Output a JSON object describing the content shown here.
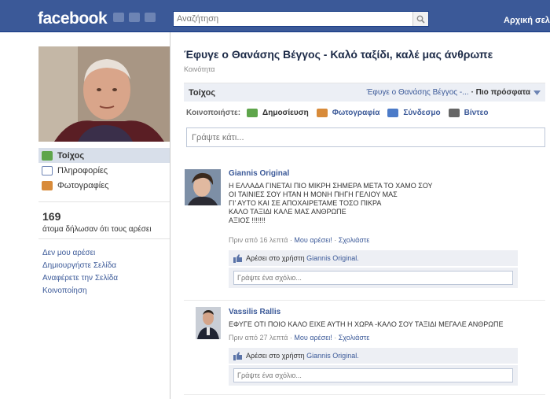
{
  "topbar": {
    "logo": "facebook",
    "search_placeholder": "Αναζήτηση",
    "home_link": "Αρχική σελί"
  },
  "sidebar": {
    "items": [
      {
        "label": "Τοίχος"
      },
      {
        "label": "Πληροφορίες"
      },
      {
        "label": "Φωτογραφίες"
      }
    ],
    "likes_count": "169",
    "likes_text": "άτομα δήλωσαν ότι τους αρέσει",
    "links": [
      {
        "label": "Δεν μου αρέσει"
      },
      {
        "label": "Δημιουργήστε Σελίδα"
      },
      {
        "label": "Αναφέρετε την Σελίδα"
      },
      {
        "label": "Κοινοποίηση"
      }
    ]
  },
  "page": {
    "title": "Έφυγε ο Θανάσης Βέγγος - Καλό ταξίδι, καλέ μας άνθρωπε",
    "category": "Κοινότητα"
  },
  "wall": {
    "tab": "Τοίχος",
    "filter": "Έφυγε ο Θανάσης Βέγγος -...",
    "sort": "· Πιο πρόσφατα"
  },
  "share": {
    "label": "Κοινοποιήστε:",
    "post": "Δημοσίευση",
    "photo": "Φωτογραφία",
    "link": "Σύνδεσμο",
    "video": "Βίντεο"
  },
  "composer": {
    "placeholder": "Γράψτε κάτι..."
  },
  "posts": [
    {
      "author": "Giannis Original",
      "lines": [
        "Η ΕΛΛΑΔΑ ΓΙΝΕΤΑΙ ΠΙΟ ΜΙΚΡΗ ΣΗΜΕΡΑ ΜΕΤΑ ΤΟ ΧΑΜΟ ΣΟΥ",
        "ΟΙ ΤΑΙΝΙΕΣ ΣΟΥ ΗΤΑΝ Η ΜΟΝΗ ΠΗΓΗ ΓΕΛΙΟΥ ΜΑΣ",
        "ΓΙ' ΑΥΤΟ ΚΑΙ ΣΕ ΑΠΟΧΑΙΡΕΤΑΜΕ ΤΟΣΟ ΠΙΚΡΑ",
        "ΚΑΛΟ ΤΑΞΙΔΙ ΚΑΛΕ ΜΑΣ ΑΝΘΡΩΠΕ",
        "ΑΞΙΟΣ !!!!!!!"
      ],
      "time": "Πριν από 16 λεπτά",
      "like_action": "Μου αρέσει!",
      "comment_action": "Σχολιάστε",
      "like_prefix": "Αρέσει στο χρήστη",
      "like_user": "Giannis Original.",
      "comment_placeholder": "Γράψτε ένα σχόλιο..."
    },
    {
      "author": "Vassilis Rallis",
      "lines": [
        "ΕΦΥΓΕ ΟΤΙ ΠΟΙΟ ΚΑΛΟ ΕΙΧΕ ΑΥΤΗ Η ΧΩΡΑ -ΚΑΛΟ ΣΟΥ ΤΑΞΙΔΙ ΜΕΓΑΛΕ ΑΝΘΡΩΠΕ"
      ],
      "time": "Πριν από 27 λεπτά",
      "like_action": "Μου αρέσει!",
      "comment_action": "Σχολιάστε",
      "like_prefix": "Αρέσει στο χρήστη",
      "like_user": "Giannis Original.",
      "comment_placeholder": "Γράψτε ένα σχόλιο..."
    }
  ],
  "colors": {
    "brand": "#3b5998",
    "link": "#3b5998",
    "panel": "#edeff4"
  }
}
